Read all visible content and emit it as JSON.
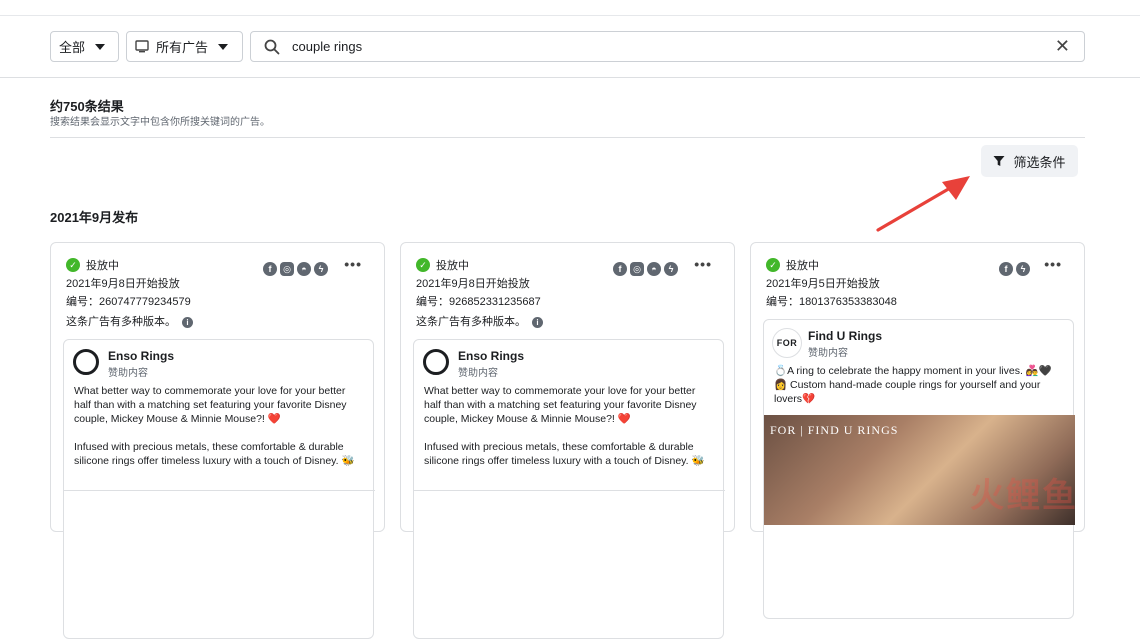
{
  "toolbar": {
    "scope_label": "全部",
    "adtype_label": "所有广告",
    "search_value": "couple rings",
    "clear_glyph": "✕"
  },
  "results": {
    "count": "约750条结果",
    "note": "搜索结果会显示文字中包含你所搜关键词的广告。"
  },
  "filter_label": "筛选条件",
  "section_title": "2021年9月发布",
  "cards": [
    {
      "status": "投放中",
      "start": "2021年9月8日开始投放",
      "id": "编号：260747779234579",
      "versions": "这条广告有多种版本。",
      "platforms": [
        "facebook-icon",
        "instagram-icon",
        "audience-network-icon",
        "messenger-icon"
      ],
      "brand": "Enso Rings",
      "sponsored": "赞助内容",
      "body1": "What better way to commemorate your love for your better half than with a matching set featuring your favorite Disney couple, Mickey Mouse & Minnie Mouse?! ❤️",
      "body2": "Infused with precious metals, these comfortable & durable silicone rings offer timeless luxury with a touch of Disney. 🐝"
    },
    {
      "status": "投放中",
      "start": "2021年9月8日开始投放",
      "id": "编号：926852331235687",
      "versions": "这条广告有多种版本。",
      "platforms": [
        "facebook-icon",
        "instagram-icon",
        "audience-network-icon",
        "messenger-icon"
      ],
      "brand": "Enso Rings",
      "sponsored": "赞助内容",
      "body1": "What better way to commemorate your love for your better half than with a matching set featuring your favorite Disney couple, Mickey Mouse & Minnie Mouse?! ❤️",
      "body2": "Infused with precious metals, these comfortable & durable silicone rings offer timeless luxury with a touch of Disney. 🐝"
    },
    {
      "status": "投放中",
      "start": "2021年9月5日开始投放",
      "id": "编号：1801376353383048",
      "platforms": [
        "facebook-icon",
        "messenger-icon"
      ],
      "brand": "Find U Rings",
      "logo_text": "FOR",
      "sponsored": "赞助内容",
      "body1": "💍A ring to celebrate the happy moment in your lives. 👩‍❤️‍👨🖤 👩 Custom hand-made couple rings for yourself and your lovers💔",
      "photo_caption": "FOR | FIND U RINGS"
    }
  ],
  "watermark": "火鲤鱼",
  "colors": {
    "active_green": "#42b72a",
    "arrow_red": "#e8413a",
    "border": "#dddfe2"
  }
}
